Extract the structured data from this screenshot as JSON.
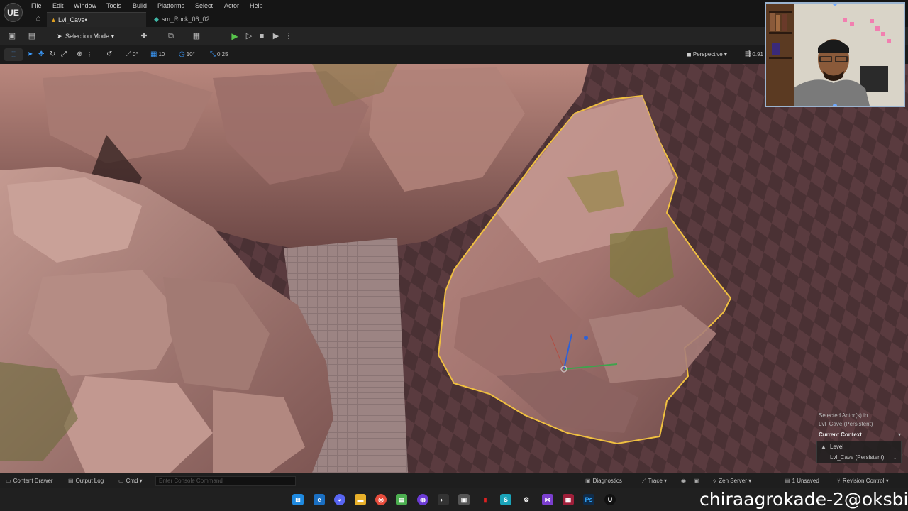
{
  "app": {
    "logo_label": "UE"
  },
  "menu": [
    "File",
    "Edit",
    "Window",
    "Tools",
    "Build",
    "Platforms",
    "Select",
    "Actor",
    "Help"
  ],
  "tabs": {
    "active": {
      "label": "Lvl_Cave•",
      "icon": "level-icon"
    },
    "inactive": {
      "label": "sm_Rock_06_02",
      "icon": "static-mesh-icon"
    }
  },
  "toolbar": {
    "selection_mode_label": "Selection Mode",
    "icons": [
      "save-icon",
      "content-icon",
      "add-actor-icon",
      "blueprint-icon",
      "cinematics-icon",
      "play-icon",
      "step-icon",
      "stop-icon",
      "launch-icon",
      "more-icon"
    ]
  },
  "viewport_toolbar": {
    "rotate_snap_value": "0°",
    "grid_snap_value": "10",
    "angle_snap_value": "10°",
    "scale_snap_value": "0.25",
    "view_mode_label": "Perspective",
    "camera_speed_value": "0.91"
  },
  "viewport": {
    "selected_info_line1": "Selected Actor(s) in",
    "selected_info_line2": "Lvl_Cave (Persistent)",
    "current_context_label": "Current Context",
    "level_label": "Level",
    "level_value": "Lvl_Cave (Persistent)",
    "selection_outline_color": "#f0c040"
  },
  "statusbar": {
    "content_drawer_label": "Content Drawer",
    "output_log_label": "Output Log",
    "cmd_label": "Cmd",
    "console_placeholder": "Enter Console Command",
    "diagnostics_label": "Diagnostics",
    "trace_label": "Trace",
    "zen_server_label": "Zen Server",
    "unsaved_label": "1 Unsaved",
    "revision_control_label": "Revision Control"
  },
  "taskbar": {
    "icons": [
      "windows-start-icon",
      "edge-icon",
      "discord-icon",
      "file-explorer-icon",
      "chrome-icon",
      "notepad-icon",
      "obs-icon",
      "terminal-icon",
      "app-icon",
      "app-red-icon",
      "app-teal-icon",
      "steam-icon",
      "visual-studio-icon",
      "substance-icon",
      "photoshop-icon",
      "unreal-icon"
    ],
    "overlay_text": "chiraagrokade-2@oksbi"
  }
}
